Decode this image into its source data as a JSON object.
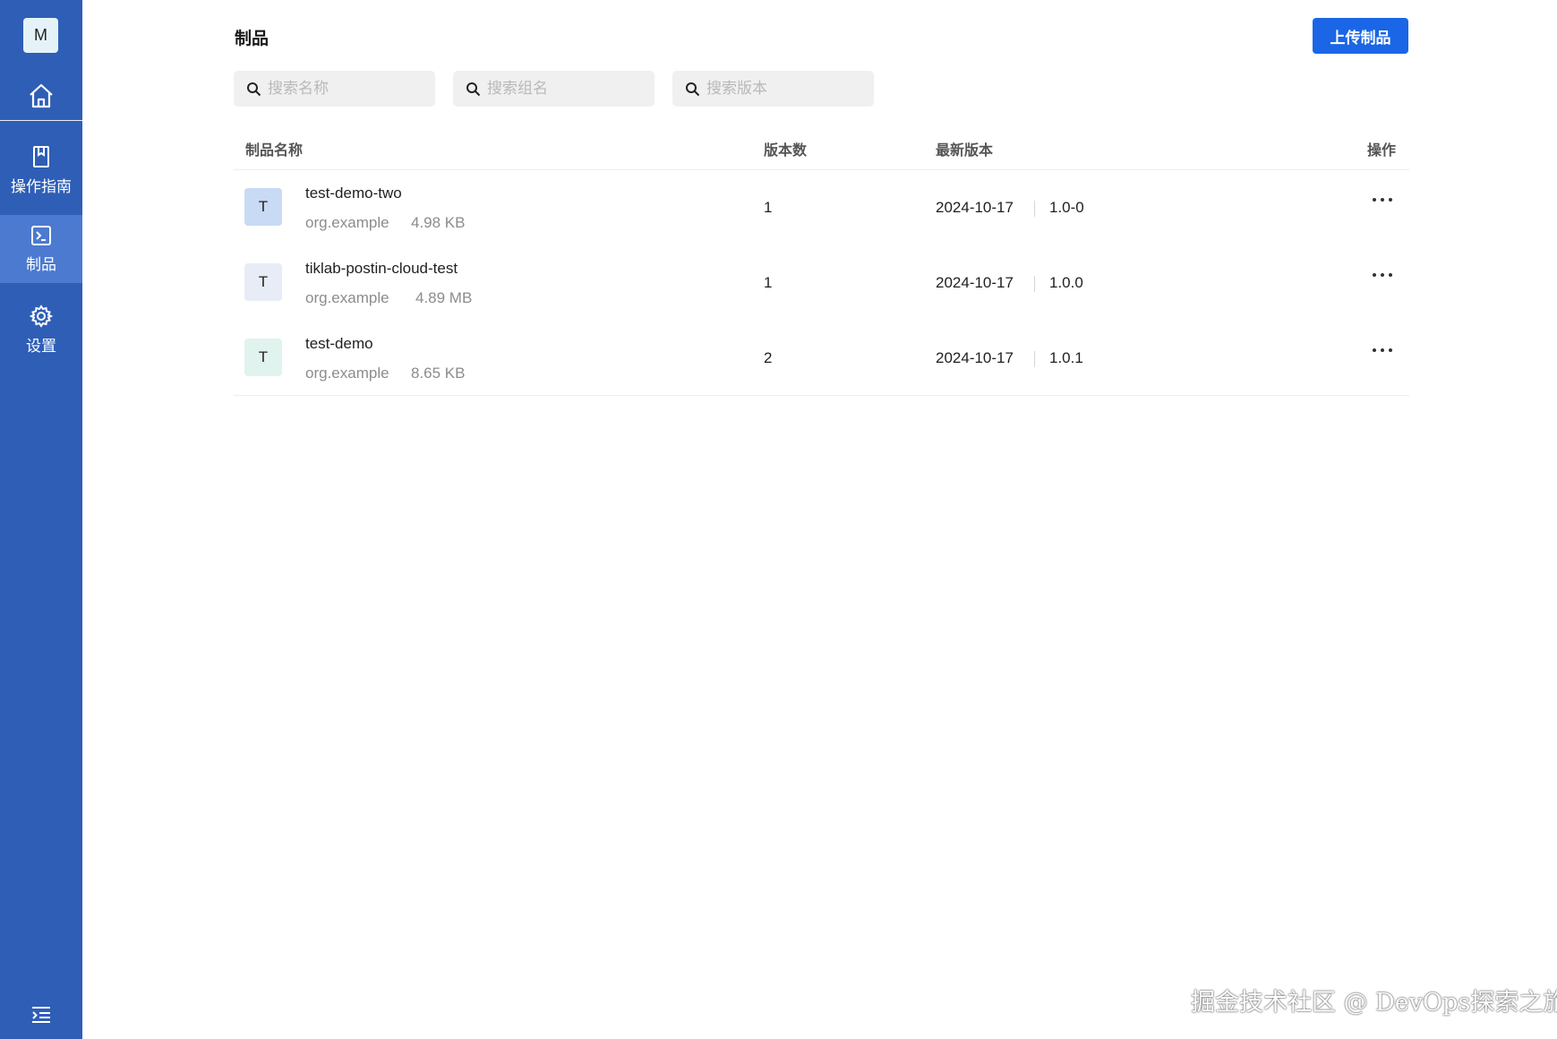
{
  "sidebar": {
    "logo": "M",
    "home_icon": "home-icon",
    "items": [
      {
        "label": "操作指南",
        "icon": "book-icon"
      },
      {
        "label": "制品",
        "icon": "terminal-icon",
        "active": true
      },
      {
        "label": "设置",
        "icon": "gear-icon"
      }
    ],
    "collapse_icon": "menu-collapse-icon"
  },
  "header": {
    "title": "制品",
    "upload_label": "上传制品"
  },
  "search": {
    "name_placeholder": "搜索名称",
    "group_placeholder": "搜索组名",
    "version_placeholder": "搜索版本"
  },
  "table": {
    "columns": [
      "制品名称",
      "版本数",
      "最新版本",
      "操作"
    ],
    "rows": [
      {
        "avatar": "T",
        "avatar_color": "#c9daf4",
        "name": "test-demo-two",
        "group": "org.example",
        "size": "4.98 KB",
        "versions": "1",
        "date": "2024-10-17",
        "latest": "1.0-0"
      },
      {
        "avatar": "T",
        "avatar_color": "#e8ecf6",
        "name": "tiklab-postin-cloud-test",
        "group": "org.example",
        "size": "4.89 MB",
        "versions": "1",
        "date": "2024-10-17",
        "latest": "1.0.0"
      },
      {
        "avatar": "T",
        "avatar_color": "#e0f3ee",
        "name": "test-demo",
        "group": "org.example",
        "size": "8.65 KB",
        "versions": "2",
        "date": "2024-10-17",
        "latest": "1.0.1"
      }
    ]
  },
  "watermark": "掘金技术社区 @ DevOps探索之旅",
  "colors": {
    "sidebar": "#2f5eb7",
    "sidebar_active": "#4b7ad0",
    "primary": "#1a66e6"
  }
}
